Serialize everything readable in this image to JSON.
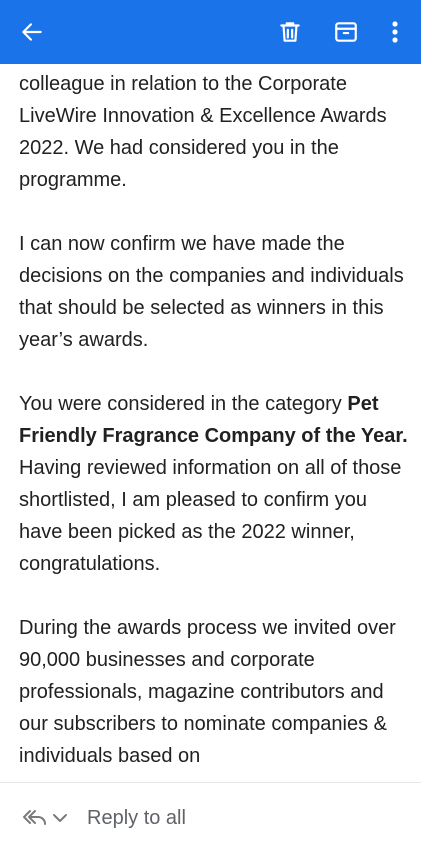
{
  "topbar": {
    "back_icon": "arrow-left-icon",
    "delete_icon": "trash-icon",
    "archive_icon": "archive-icon",
    "more_icon": "more-vertical-icon",
    "color": "#1a73e8"
  },
  "email": {
    "p1": "colleague in relation to the Corporate LiveWire Innovation & Excellence Awards 2022. We had considered you in the programme.",
    "p2": "I can now confirm we have made the decisions on the companies and individuals that should be selected as winners in this year’s awards.",
    "p3_pre": "You were considered in the category ",
    "p3_bold": "Pet Friendly Fragrance Company of the Year.",
    "p3_post": "  Having reviewed information on all of those shortlisted, I am pleased to confirm you have been picked as the 2022 winner, congratulations.",
    "p4": "During the awards process we invited over 90,000 businesses and corporate professionals, magazine contributors and our subscribers to nominate companies & individuals based on"
  },
  "footer": {
    "reply_icon": "reply-all-icon",
    "chevron_icon": "chevron-down-icon",
    "reply_label": "Reply to all"
  }
}
